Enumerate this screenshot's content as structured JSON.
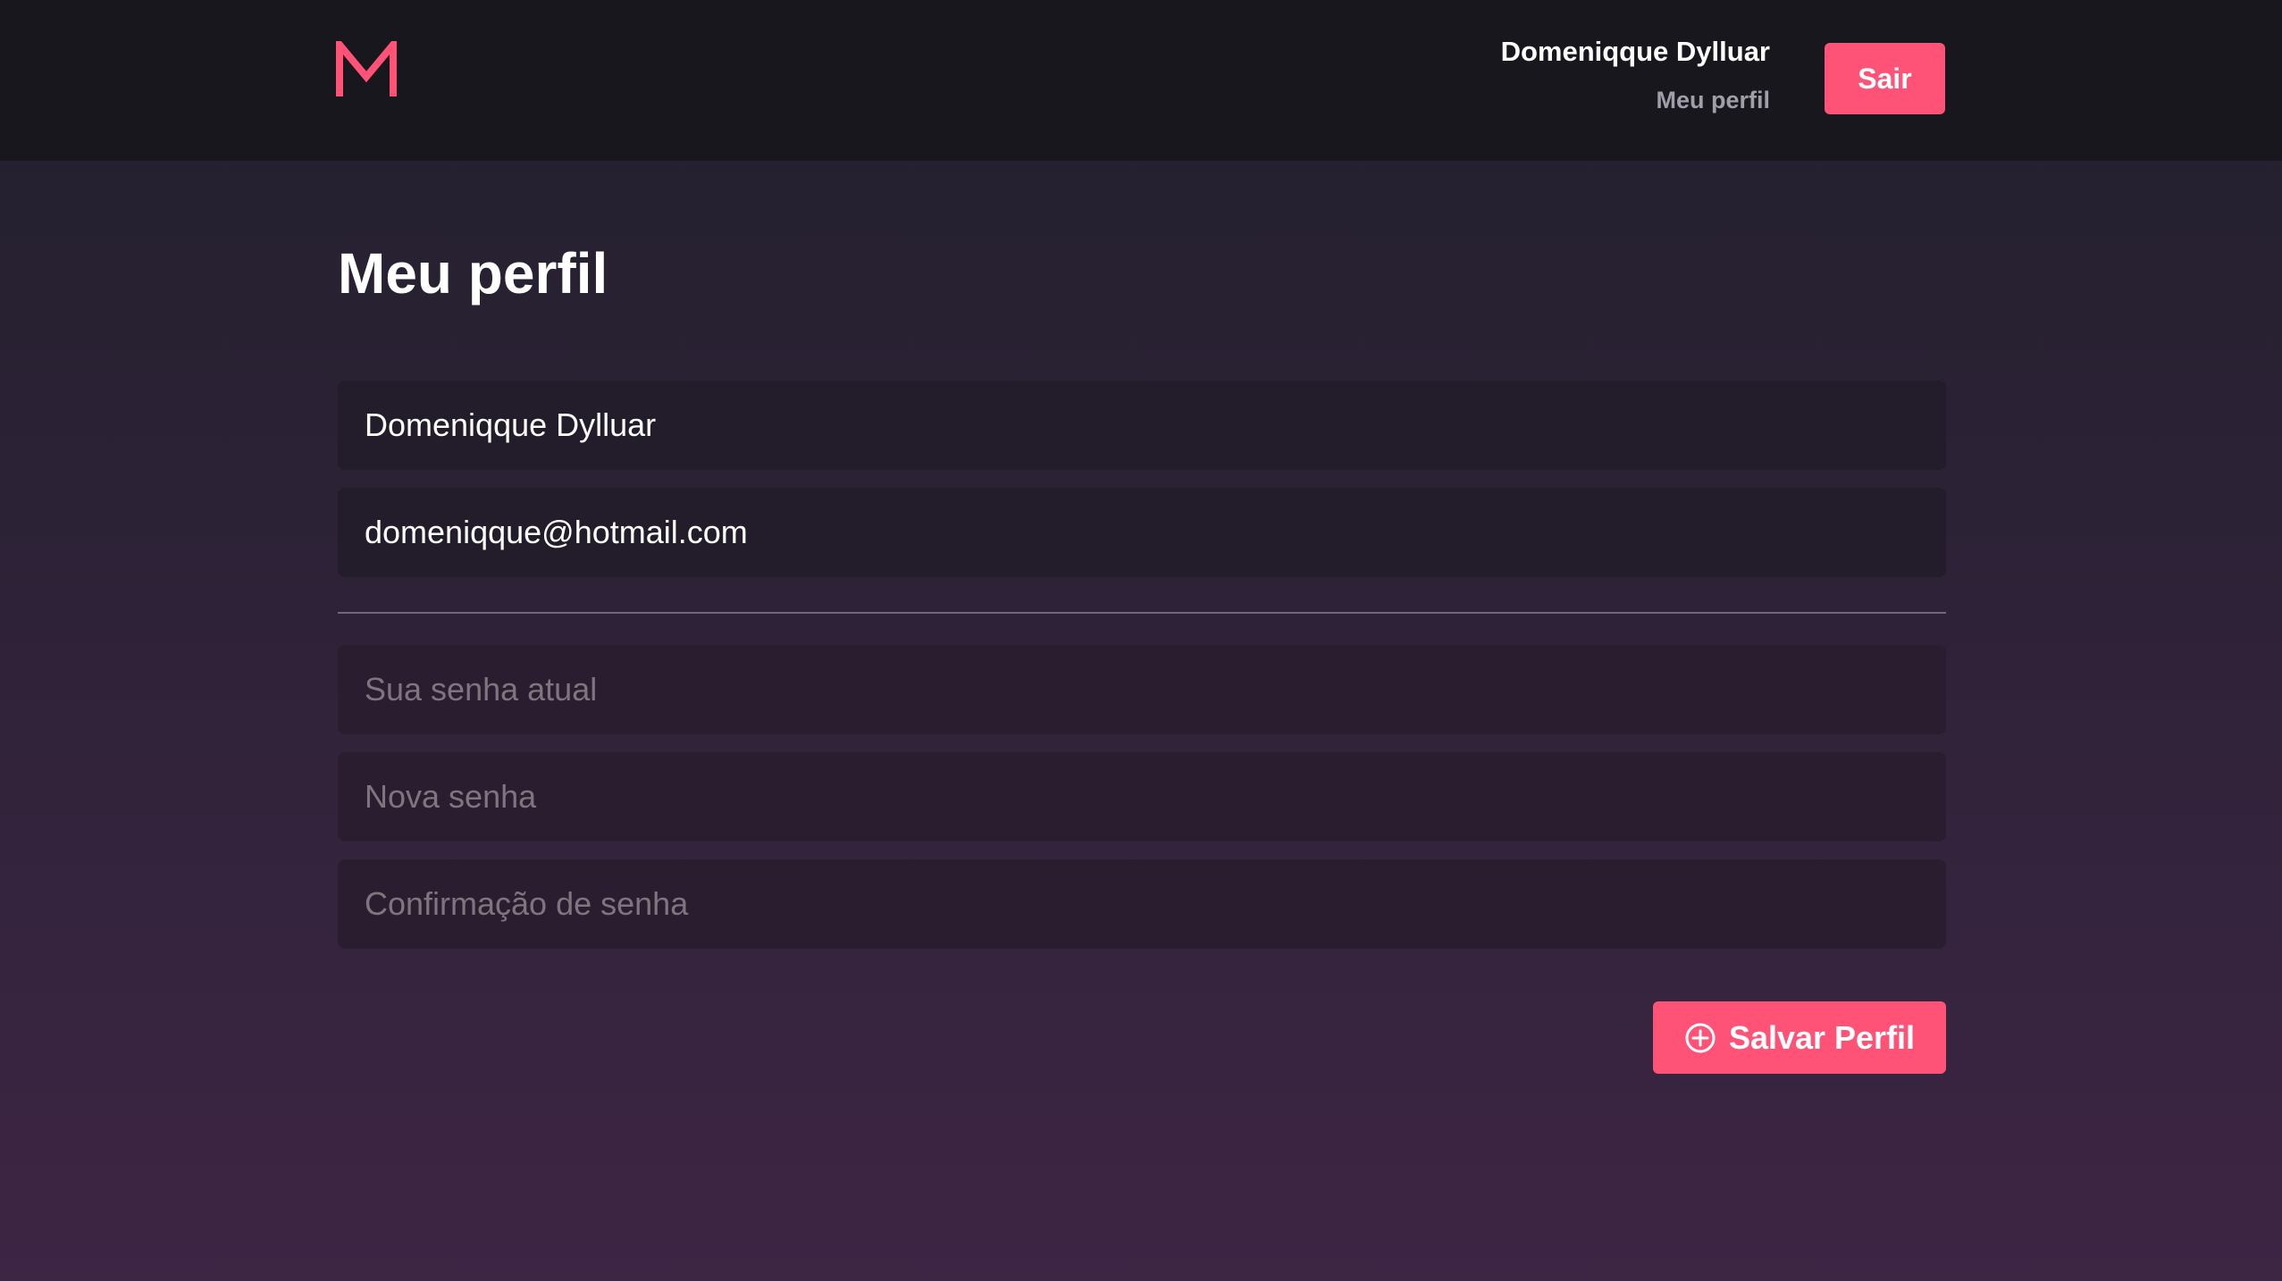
{
  "header": {
    "logo_text": "M",
    "user_name": "Domeniqque Dylluar",
    "profile_link": "Meu perfil",
    "logout_label": "Sair"
  },
  "main": {
    "title": "Meu perfil",
    "form": {
      "name_value": "Domeniqque Dylluar",
      "email_value": "domeniqque@hotmail.com",
      "old_password_placeholder": "Sua senha atual",
      "new_password_placeholder": "Nova senha",
      "confirm_password_placeholder": "Confirmação de senha",
      "save_label": "Salvar Perfil"
    }
  },
  "icons": {
    "logo": "m-logo-icon",
    "save": "plus-circle-icon"
  },
  "colors": {
    "accent": "#ff5277",
    "header_bg": "#18171d",
    "input_bg": "#231c2b"
  }
}
